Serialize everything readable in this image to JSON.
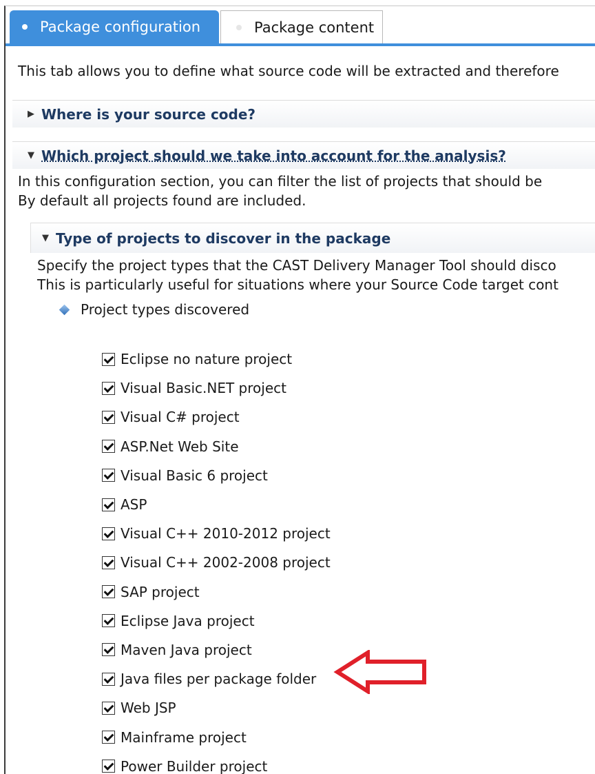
{
  "tabs": [
    {
      "label": "Package configuration",
      "active": true
    },
    {
      "label": "Package content",
      "active": false
    }
  ],
  "intro_text": "This tab allows you to define what source code will be extracted and therefore",
  "sections": [
    {
      "title": "Where is your source code?",
      "expanded": false
    },
    {
      "title": "Which project should we take into account for the analysis?",
      "expanded": true,
      "description_lines": [
        "In this configuration section, you can filter the list of projects that should be",
        "By default all projects found are included."
      ]
    }
  ],
  "subsection": {
    "title": "Type of projects to discover in the package",
    "expanded": true,
    "description_lines": [
      "Specify the project types that the CAST Delivery Manager Tool should disco",
      "This is particularly useful for situations where your Source Code target cont"
    ]
  },
  "tree_node": {
    "label": "Project types discovered",
    "icon": "diamond-icon"
  },
  "project_types": [
    {
      "label": "Eclipse no nature project",
      "checked": true
    },
    {
      "label": "Visual Basic.NET project",
      "checked": true
    },
    {
      "label": "Visual C# project",
      "checked": true
    },
    {
      "label": "ASP.Net Web Site",
      "checked": true
    },
    {
      "label": "Visual Basic 6 project",
      "checked": true
    },
    {
      "label": "ASP",
      "checked": true
    },
    {
      "label": "Visual C++ 2010-2012 project",
      "checked": true
    },
    {
      "label": "Visual C++ 2002-2008 project",
      "checked": true
    },
    {
      "label": "SAP project",
      "checked": true
    },
    {
      "label": "Eclipse Java project",
      "checked": true
    },
    {
      "label": "Maven Java project",
      "checked": true
    },
    {
      "label": "Java files per package folder",
      "checked": true
    },
    {
      "label": "Web JSP",
      "checked": true
    },
    {
      "label": "Mainframe project",
      "checked": true
    },
    {
      "label": "Power Builder project",
      "checked": true
    }
  ],
  "colors": {
    "accent": "#3f8fdc",
    "section_title": "#1e3a62",
    "annotation_arrow": "#e0202a"
  }
}
